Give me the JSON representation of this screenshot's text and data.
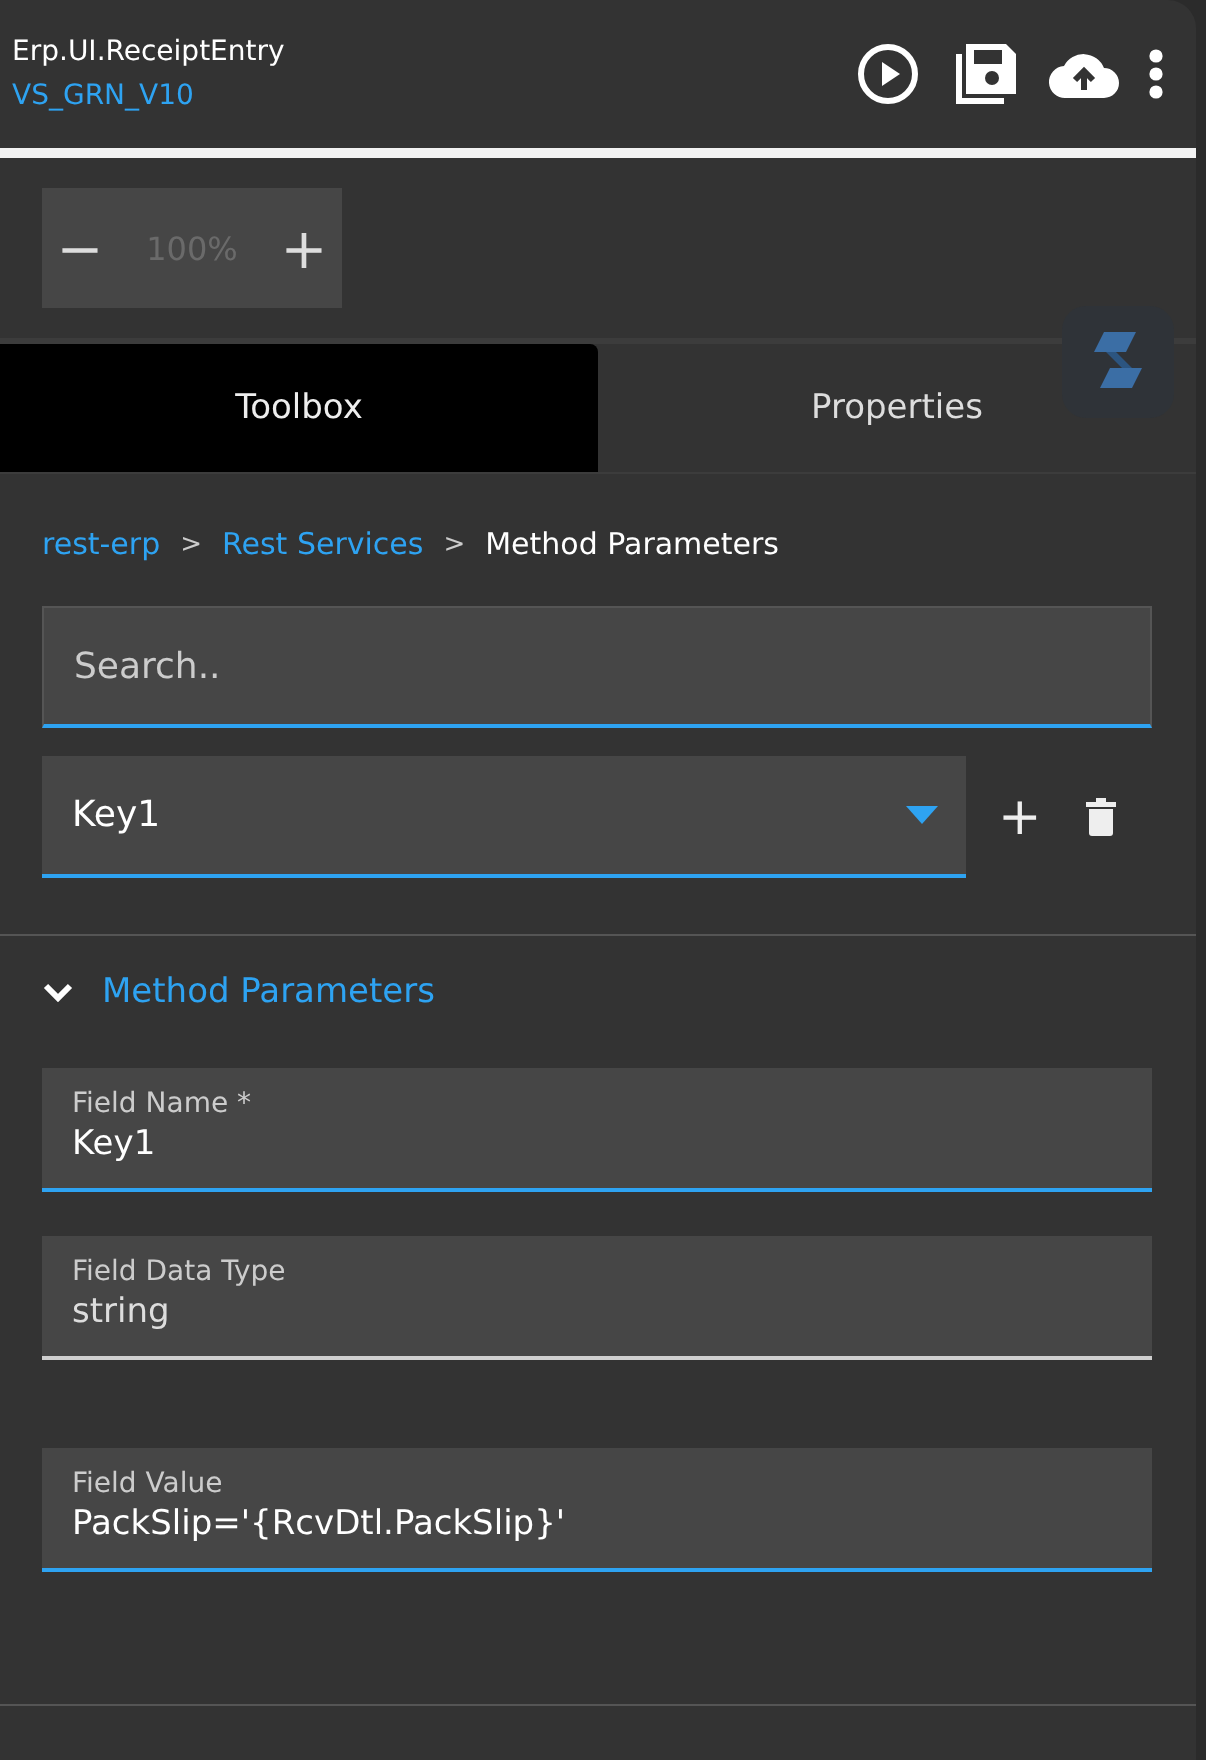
{
  "header": {
    "title": "Erp.UI.ReceiptEntry",
    "subtitle": "VS_GRN_V10"
  },
  "zoom": {
    "minus": "−",
    "value": "100%",
    "plus": "+"
  },
  "tabs": [
    {
      "label": "Toolbox",
      "selected": true
    },
    {
      "label": "Properties",
      "selected": false
    }
  ],
  "breadcrumb": [
    {
      "label": "rest-erp",
      "link": true
    },
    {
      "label": "Rest Services",
      "link": true
    },
    {
      "label": "Method Parameters",
      "link": false
    }
  ],
  "breadcrumb_separator": ">",
  "search": {
    "placeholder": "Search.."
  },
  "dropdown": {
    "value": "Key1",
    "add": "+"
  },
  "section": {
    "title": "Method Parameters",
    "expanded": true
  },
  "fields": [
    {
      "label": "Field Name *",
      "value": "Key1",
      "disabled": false
    },
    {
      "label": "Field Data Type",
      "value": "string",
      "disabled": true
    },
    {
      "label": "Field Value",
      "value": "PackSlip='{RcvDtl.PackSlip}'",
      "disabled": false
    }
  ]
}
